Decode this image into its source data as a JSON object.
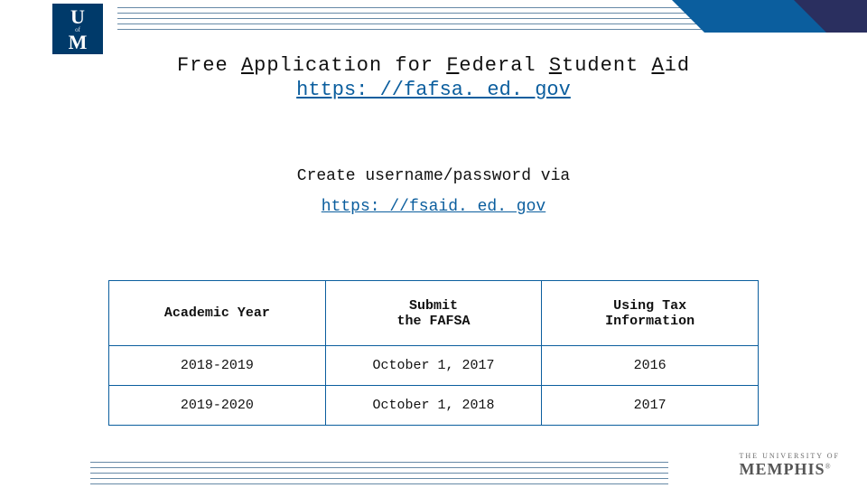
{
  "title": {
    "parts": [
      {
        "text": "Free ",
        "u": false
      },
      {
        "text": "A",
        "u": true
      },
      {
        "text": "pplication for ",
        "u": false
      },
      {
        "text": "F",
        "u": true
      },
      {
        "text": "ederal ",
        "u": false
      },
      {
        "text": "S",
        "u": true
      },
      {
        "text": "tudent ",
        "u": false
      },
      {
        "text": "A",
        "u": true
      },
      {
        "text": "id",
        "u": false
      }
    ],
    "link": "https: //fafsa. ed. gov"
  },
  "subtitle": {
    "text": "Create username/password via",
    "link": "https: //fsaid. ed. gov"
  },
  "table": {
    "headers": [
      "Academic Year",
      "Submit\nthe FAFSA",
      "Using Tax\nInformation"
    ],
    "rows": [
      [
        "2018-2019",
        "October 1, 2017",
        "2016"
      ],
      [
        "2019-2020",
        "October 1, 2018",
        "2017"
      ]
    ]
  },
  "brand": {
    "small": "THE UNIVERSITY OF",
    "big": "MEMPHIS"
  },
  "logo": {
    "u": "U",
    "of": "of",
    "m": "M"
  }
}
